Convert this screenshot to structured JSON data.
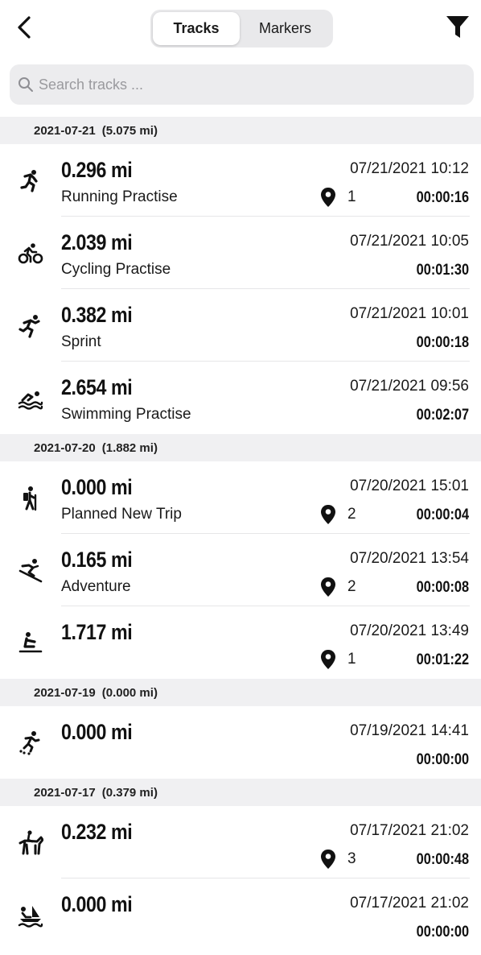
{
  "header": {
    "tabs": [
      {
        "label": "Tracks",
        "active": true
      },
      {
        "label": "Markers",
        "active": false
      }
    ]
  },
  "search": {
    "placeholder": "Search tracks ..."
  },
  "groups": [
    {
      "date": "2021-07-21",
      "total": "(5.075 mi)",
      "tracks": [
        {
          "icon": "running-icon",
          "distance": "0.296 mi",
          "name": "Running Practise",
          "datetime": "07/21/2021 10:12",
          "markers": "1",
          "duration": "00:00:16"
        },
        {
          "icon": "cycling-icon",
          "distance": "2.039 mi",
          "name": "Cycling Practise",
          "datetime": "07/21/2021 10:05",
          "markers": "",
          "duration": "00:01:30"
        },
        {
          "icon": "sprint-icon",
          "distance": "0.382 mi",
          "name": "Sprint",
          "datetime": "07/21/2021 10:01",
          "markers": "",
          "duration": "00:00:18"
        },
        {
          "icon": "swimming-icon",
          "distance": "2.654 mi",
          "name": "Swimming Practise",
          "datetime": "07/21/2021 09:56",
          "markers": "",
          "duration": "00:02:07"
        }
      ]
    },
    {
      "date": "2021-07-20",
      "total": "(1.882 mi)",
      "tracks": [
        {
          "icon": "hiking-icon",
          "distance": "0.000 mi",
          "name": "Planned New Trip",
          "datetime": "07/20/2021 15:01",
          "markers": "2",
          "duration": "00:00:04"
        },
        {
          "icon": "skiing-icon",
          "distance": "0.165 mi",
          "name": "Adventure",
          "datetime": "07/20/2021 13:54",
          "markers": "2",
          "duration": "00:00:08"
        },
        {
          "icon": "rowing-icon",
          "distance": "1.717 mi",
          "name": "",
          "datetime": "07/20/2021 13:49",
          "markers": "1",
          "duration": "00:01:22"
        }
      ]
    },
    {
      "date": "2021-07-19",
      "total": "(0.000 mi)",
      "tracks": [
        {
          "icon": "inline-skating-icon",
          "distance": "0.000 mi",
          "name": "",
          "datetime": "07/19/2021 14:41",
          "markers": "",
          "duration": "00:00:00"
        }
      ]
    },
    {
      "date": "2021-07-17",
      "total": "(0.379 mi)",
      "tracks": [
        {
          "icon": "horse-riding-icon",
          "distance": "0.232 mi",
          "name": "",
          "datetime": "07/17/2021 21:02",
          "markers": "3",
          "duration": "00:00:48"
        },
        {
          "icon": "sailing-icon",
          "distance": "0.000 mi",
          "name": "",
          "datetime": "07/17/2021 21:02",
          "markers": "",
          "duration": "00:00:00"
        }
      ]
    }
  ]
}
